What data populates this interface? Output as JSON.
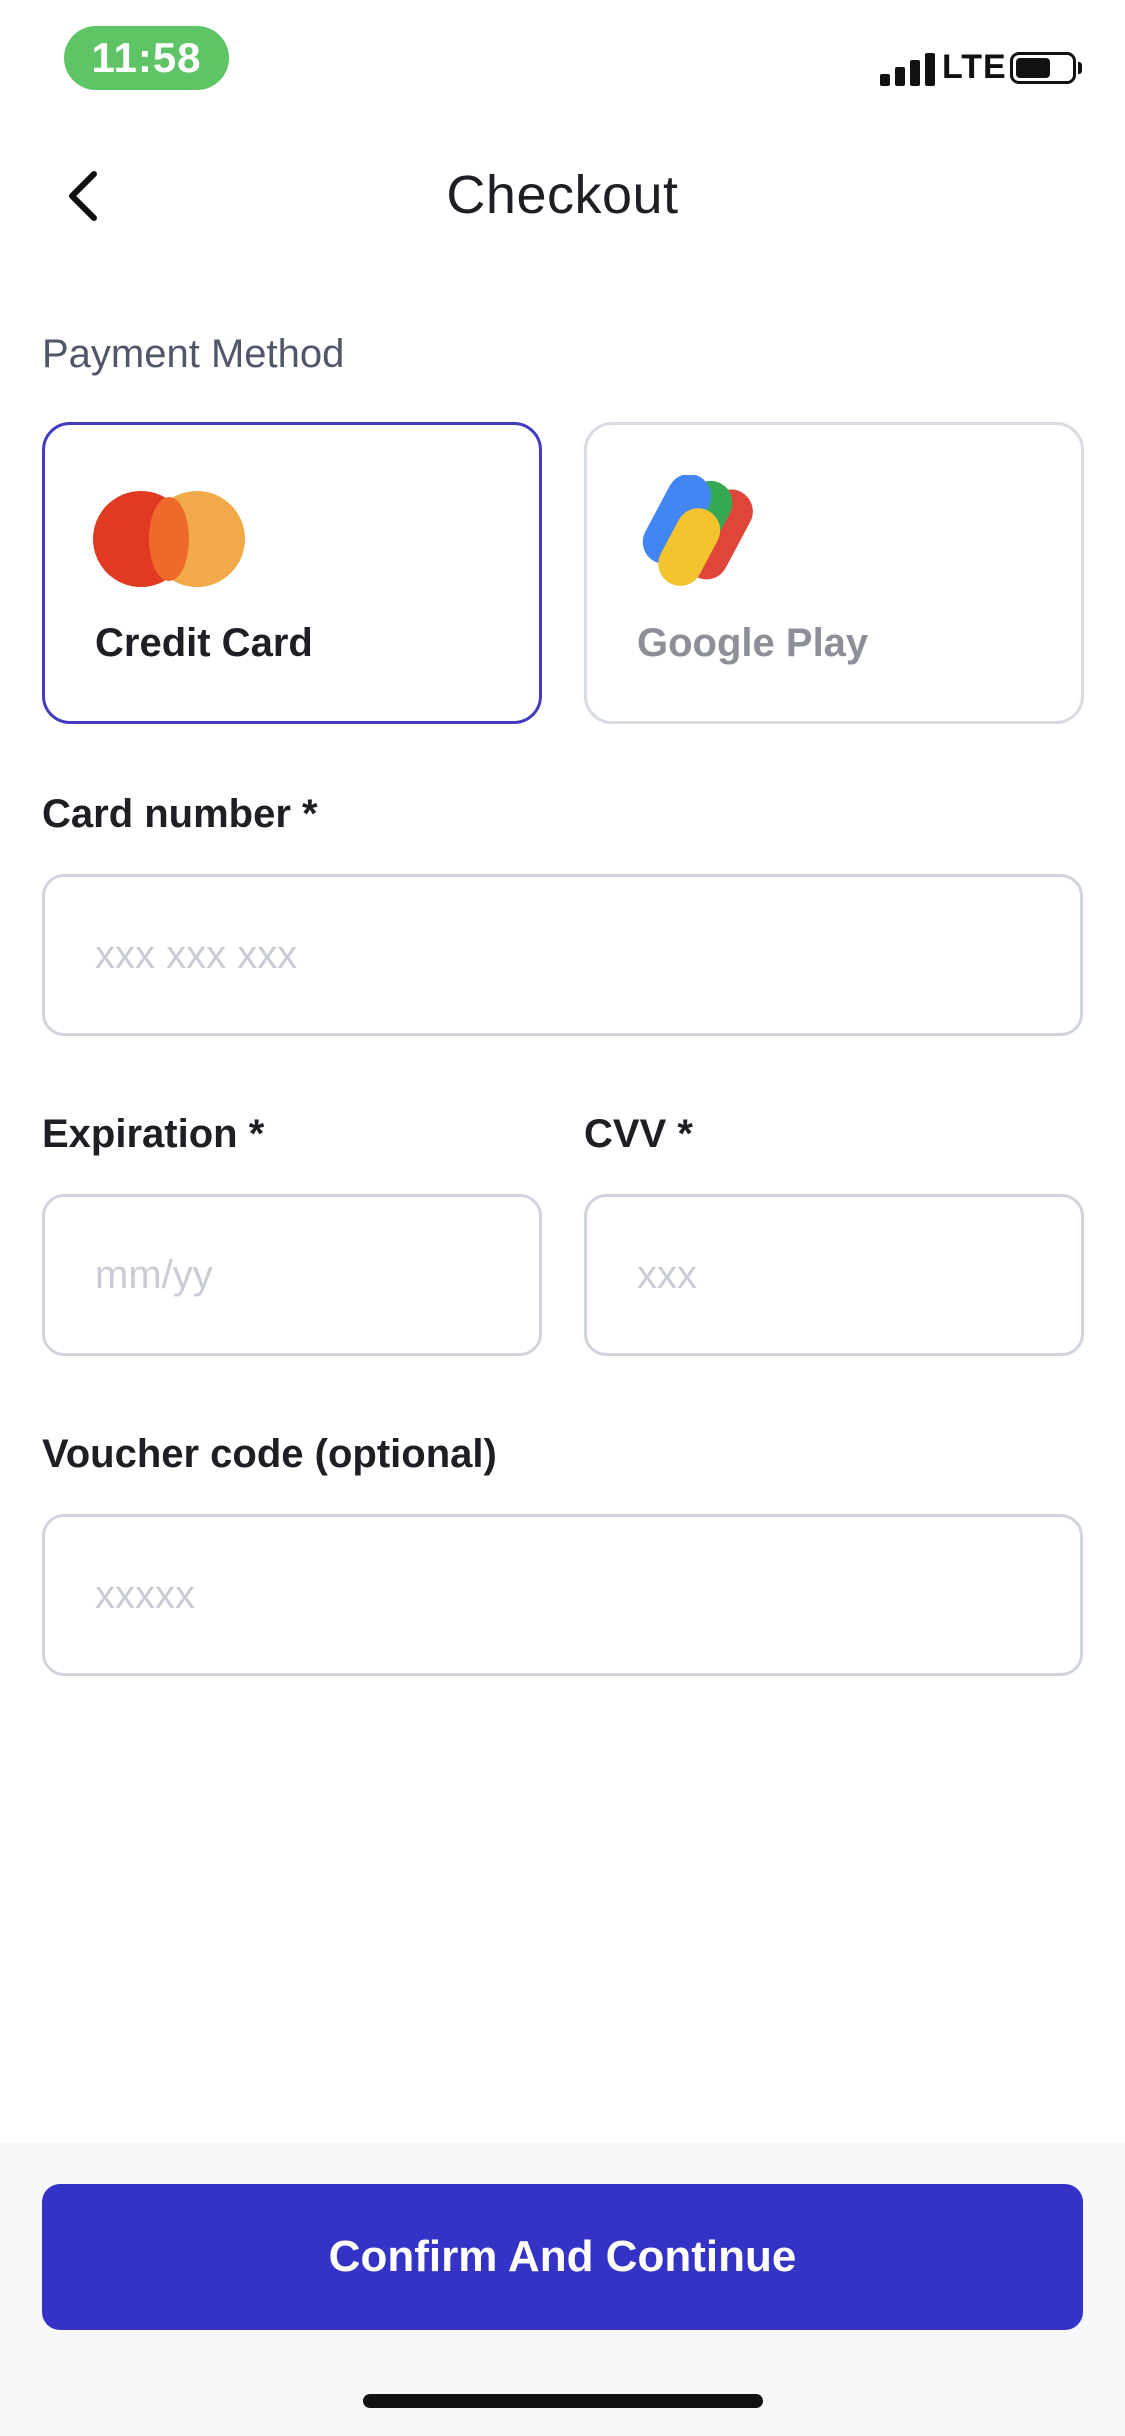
{
  "status_bar": {
    "time": "11:58",
    "network": "LTE",
    "icons": [
      "signal-icon",
      "battery-icon"
    ]
  },
  "header": {
    "back_icon": "chevron-left-icon",
    "title": "Checkout"
  },
  "payment": {
    "section_label": "Payment Method",
    "methods": [
      {
        "label": "Credit Card",
        "icon": "mastercard-logo",
        "selected": true
      },
      {
        "label": "Google Play",
        "icon": "google-pay-logo",
        "selected": false
      }
    ]
  },
  "form": {
    "card_number": {
      "label": "Card number *",
      "placeholder": "xxx xxx xxx",
      "value": ""
    },
    "expiration": {
      "label": "Expiration *",
      "placeholder": "mm/yy",
      "value": ""
    },
    "cvv": {
      "label": "CVV *",
      "placeholder": "xxx",
      "value": ""
    },
    "voucher": {
      "label": "Voucher code (optional)",
      "placeholder": "xxxxx",
      "value": ""
    }
  },
  "footer": {
    "confirm_label": "Confirm And Continue"
  },
  "colors": {
    "primary": "#3433c6",
    "selected_border": "#3f3cc0",
    "time_pill": "#5fc466"
  }
}
